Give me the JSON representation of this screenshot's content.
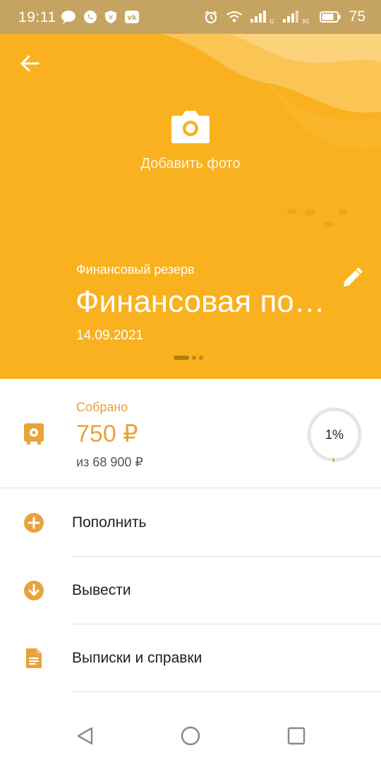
{
  "status_bar": {
    "time": "19:11",
    "battery": "75",
    "left_icons": [
      "message-icon",
      "whatsapp-icon",
      "bank-icon",
      "vk-icon"
    ],
    "right_icons": [
      "alarm-icon",
      "wifi-icon",
      "signal-icon",
      "signal-3g-icon",
      "battery-icon"
    ]
  },
  "hero": {
    "add_photo_label": "Добавить фото",
    "subtitle": "Финансовый резерв",
    "title": "Финансовая по…",
    "date": "14.09.2021",
    "pager": {
      "pages": 3,
      "active": 1
    },
    "background_color": "#f9b11f"
  },
  "collected": {
    "label": "Собрано",
    "amount": "750 ₽",
    "total": "из 68 900 ₽",
    "progress_text": "1%",
    "progress_fraction": 0.011,
    "accent_color": "#e8a33b"
  },
  "actions": [
    {
      "label": "Пополнить",
      "icon": "plus-circle-icon"
    },
    {
      "label": "Вывести",
      "icon": "arrow-down-circle-icon"
    },
    {
      "label": "Выписки и справки",
      "icon": "document-icon"
    }
  ],
  "nav_bar": {
    "buttons": [
      "back-triangle-icon",
      "home-circle-icon",
      "recents-square-icon"
    ]
  }
}
